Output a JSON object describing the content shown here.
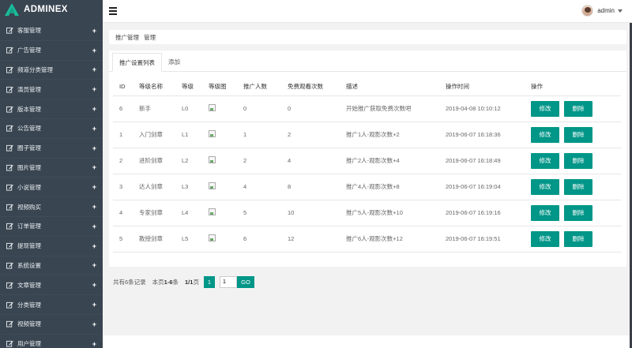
{
  "brand": {
    "name_part1": "ADMIN",
    "name_part2": "EX"
  },
  "sidebar": {
    "items": [
      {
        "label": "客服管理",
        "icon": "edit-icon"
      },
      {
        "label": "广告管理",
        "icon": "edit-icon"
      },
      {
        "label": "频道分类管理",
        "icon": "edit-icon"
      },
      {
        "label": "演员管理",
        "icon": "edit-icon"
      },
      {
        "label": "版本管理",
        "icon": "edit-icon"
      },
      {
        "label": "公告管理",
        "icon": "edit-icon"
      },
      {
        "label": "圈子管理",
        "icon": "edit-icon"
      },
      {
        "label": "图片管理",
        "icon": "edit-icon"
      },
      {
        "label": "小说管理",
        "icon": "edit-icon"
      },
      {
        "label": "视频购买",
        "icon": "edit-icon"
      },
      {
        "label": "订单管理",
        "icon": "edit-icon"
      },
      {
        "label": "提现管理",
        "icon": "edit-icon"
      },
      {
        "label": "系统设置",
        "icon": "edit-icon"
      },
      {
        "label": "文章管理",
        "icon": "edit-icon"
      },
      {
        "label": "分类管理",
        "icon": "edit-icon"
      },
      {
        "label": "视频管理",
        "icon": "edit-icon"
      },
      {
        "label": "用户管理",
        "icon": "edit-icon"
      }
    ],
    "expand_symbol": "+"
  },
  "topbar": {
    "username": "admin"
  },
  "breadcrumb": {
    "part1": "推广管理",
    "part2": "管理"
  },
  "tabs": [
    {
      "label": "推广设置列表"
    },
    {
      "label": "添加"
    }
  ],
  "table": {
    "headers": [
      "ID",
      "等级名称",
      "等级",
      "等级图",
      "推广人数",
      "免费观看次数",
      "描述",
      "操作时间",
      "操作"
    ],
    "rows": [
      {
        "id": "6",
        "name": "新手",
        "level": "L0",
        "count": "0",
        "free": "0",
        "desc": "开始推广获取免费次数吧",
        "time": "2019-04-08 10:10:12"
      },
      {
        "id": "1",
        "name": "入门剑章",
        "level": "L1",
        "count": "1",
        "free": "2",
        "desc": "推广1人-观影次数+2",
        "time": "2019-06-07 16:18:36"
      },
      {
        "id": "2",
        "name": "进阶剑章",
        "level": "L2",
        "count": "2",
        "free": "4",
        "desc": "推广2人-观影次数+4",
        "time": "2019-06-07 16:18:49"
      },
      {
        "id": "3",
        "name": "达人剑章",
        "level": "L3",
        "count": "4",
        "free": "8",
        "desc": "推广4人-观影次数+8",
        "time": "2019-06-07 16:19:04"
      },
      {
        "id": "4",
        "name": "专家剑章",
        "level": "L4",
        "count": "5",
        "free": "10",
        "desc": "推广5人-观影次数+10",
        "time": "2019-06-07 16:19:16"
      },
      {
        "id": "5",
        "name": "教授剑章",
        "level": "L5",
        "count": "6",
        "free": "12",
        "desc": "推广6人-观影次数+12",
        "time": "2019-06-07 16:19:51"
      }
    ],
    "edit_label": "修改",
    "delete_label": "删除"
  },
  "pagination": {
    "total_text": "共有6条记录",
    "page_range_prefix": "本页",
    "page_range": "1-6",
    "page_range_suffix": "条",
    "pages": "1/1",
    "pages_suffix": "页",
    "current": "1",
    "input_value": "1",
    "go_label": "GO"
  },
  "colors": {
    "sidebar": "#394551",
    "accent": "#009688"
  }
}
